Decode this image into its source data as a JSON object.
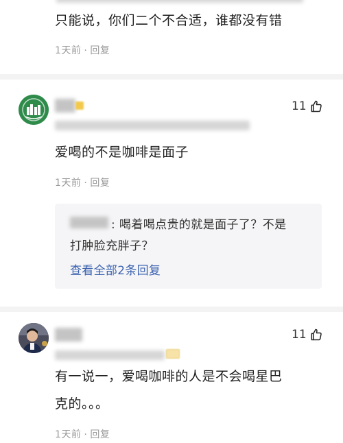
{
  "comments": [
    {
      "text": "只能说，你们二个不合适，谁都没有错",
      "time": "1天前",
      "reply": "回复"
    },
    {
      "text": "爱喝的不是咖啡是面子",
      "time": "1天前",
      "reply": "回复",
      "likes": "11",
      "sub_reply": {
        "text_line1": ": 喝着喝点贵的就是面子了？不是",
        "text_line2": "打肿脸充胖子？",
        "view_all": "查看全部2条回复"
      }
    },
    {
      "text_line1": "有一说一，爱喝咖啡的人是不会喝星巴",
      "text_line2": "克的。。。",
      "time": "1天前",
      "reply": "回复",
      "likes": "11"
    }
  ],
  "colors": {
    "link": "#3b62b0",
    "avatar_green": "#2e8b4a",
    "badge_gold": "#f2c94c"
  },
  "icons": [
    "thumbs-up-icon"
  ]
}
